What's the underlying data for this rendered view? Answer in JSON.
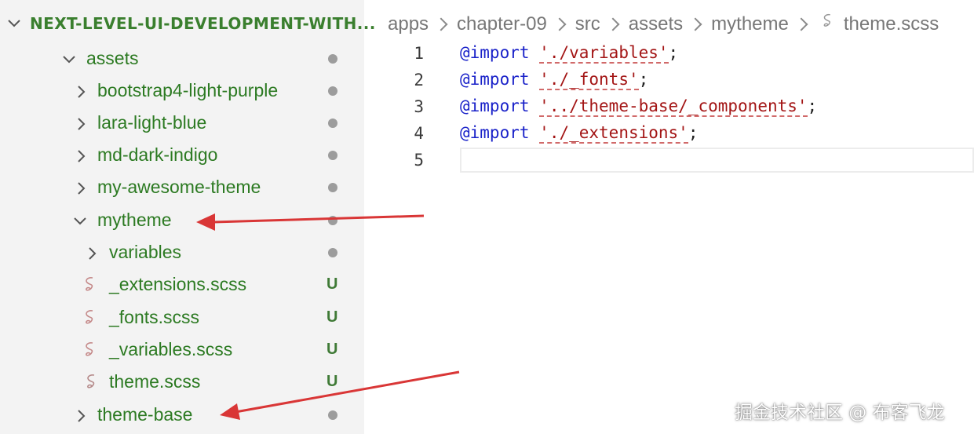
{
  "explorer": {
    "project_title": "NEXT-LEVEL-UI-DEVELOPMENT-WITH...",
    "items": [
      {
        "label": "assets",
        "kind": "folder",
        "expanded": true,
        "status": "dot"
      },
      {
        "label": "bootstrap4-light-purple",
        "kind": "folder",
        "expanded": false,
        "status": "dot"
      },
      {
        "label": "lara-light-blue",
        "kind": "folder",
        "expanded": false,
        "status": "dot"
      },
      {
        "label": "md-dark-indigo",
        "kind": "folder",
        "expanded": false,
        "status": "dot"
      },
      {
        "label": "my-awesome-theme",
        "kind": "folder",
        "expanded": false,
        "status": "dot"
      },
      {
        "label": "mytheme",
        "kind": "folder",
        "expanded": true,
        "status": "dot"
      },
      {
        "label": "variables",
        "kind": "folder",
        "expanded": false,
        "status": "dot"
      },
      {
        "label": "_extensions.scss",
        "kind": "scss-file",
        "status": "U"
      },
      {
        "label": "_fonts.scss",
        "kind": "scss-file",
        "status": "U"
      },
      {
        "label": "_variables.scss",
        "kind": "scss-file",
        "status": "U"
      },
      {
        "label": "theme.scss",
        "kind": "scss-file",
        "status": "U"
      },
      {
        "label": "theme-base",
        "kind": "folder",
        "expanded": false,
        "status": "dot"
      }
    ]
  },
  "breadcrumb": [
    "apps",
    "chapter-09",
    "src",
    "assets",
    "mytheme",
    "theme.scss"
  ],
  "editor": {
    "lines": [
      {
        "number": "1",
        "keyword": "@import",
        "path": "'./variables'",
        "end": ";"
      },
      {
        "number": "2",
        "keyword": "@import",
        "path": "'./_fonts'",
        "end": ";"
      },
      {
        "number": "3",
        "keyword": "@import",
        "path": "'../theme-base/_components'",
        "end": ";"
      },
      {
        "number": "4",
        "keyword": "@import",
        "path": "'./_extensions'",
        "end": ";"
      },
      {
        "number": "5",
        "keyword": "",
        "path": "",
        "end": ""
      }
    ]
  },
  "watermark": "掘金技术社区 @ 布客飞龙",
  "colors": {
    "tree_text": "#2c7a22",
    "keyword": "#1a22c9",
    "string": "#a31515",
    "annotation_arrow": "#d93636",
    "status_dot": "#9c9c9c"
  },
  "icons": {
    "chevron_right": "chevron-right-icon",
    "chevron_down": "chevron-down-icon",
    "scss_file": "sass-file-icon"
  }
}
